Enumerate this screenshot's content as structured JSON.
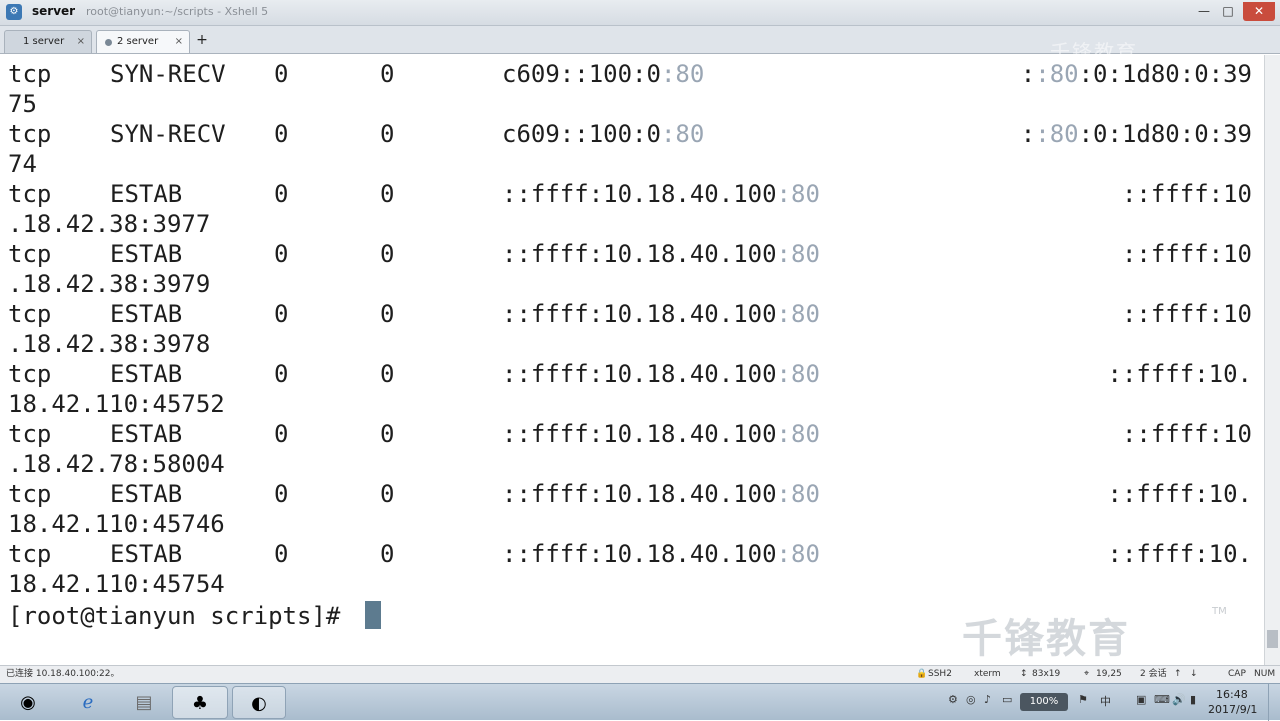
{
  "window": {
    "title": "server",
    "subtitle": "root@tianyun:~/scripts - Xshell 5",
    "minimize": "—",
    "maximize": "□",
    "close": "✕"
  },
  "tabs": [
    {
      "label": "1 server",
      "close": "×"
    },
    {
      "label": "2 server",
      "close": "×"
    }
  ],
  "tab_add": "+",
  "terminal": {
    "rows": [
      {
        "proto": "tcp",
        "state": "SYN-RECV",
        "recvq": "0",
        "sendq": "0",
        "local": "c609::100:0",
        "local_port": ":80",
        "peer_pre": ":",
        "peer_port": ":80",
        "peer_post": ":0:1d80:0:39"
      },
      {
        "wrap": "75"
      },
      {
        "proto": "tcp",
        "state": "SYN-RECV",
        "recvq": "0",
        "sendq": "0",
        "local": "c609::100:0",
        "local_port": ":80",
        "peer_pre": ":",
        "peer_port": ":80",
        "peer_post": ":0:1d80:0:39"
      },
      {
        "wrap": "74"
      },
      {
        "proto": "tcp",
        "state": "ESTAB",
        "recvq": "0",
        "sendq": "0",
        "local": "::ffff:10.18.40.100",
        "local_port": ":80",
        "peer": "::ffff:10"
      },
      {
        "wrap": ".18.42.38:3977"
      },
      {
        "proto": "tcp",
        "state": "ESTAB",
        "recvq": "0",
        "sendq": "0",
        "local": "::ffff:10.18.40.100",
        "local_port": ":80",
        "peer": "::ffff:10"
      },
      {
        "wrap": ".18.42.38:3979"
      },
      {
        "proto": "tcp",
        "state": "ESTAB",
        "recvq": "0",
        "sendq": "0",
        "local": "::ffff:10.18.40.100",
        "local_port": ":80",
        "peer": "::ffff:10"
      },
      {
        "wrap": ".18.42.38:3978"
      },
      {
        "proto": "tcp",
        "state": "ESTAB",
        "recvq": "0",
        "sendq": "0",
        "local": "::ffff:10.18.40.100",
        "local_port": ":80",
        "peer": "::ffff:10."
      },
      {
        "wrap": "18.42.110:45752"
      },
      {
        "proto": "tcp",
        "state": "ESTAB",
        "recvq": "0",
        "sendq": "0",
        "local": "::ffff:10.18.40.100",
        "local_port": ":80",
        "peer": "::ffff:10"
      },
      {
        "wrap": ".18.42.78:58004"
      },
      {
        "proto": "tcp",
        "state": "ESTAB",
        "recvq": "0",
        "sendq": "0",
        "local": "::ffff:10.18.40.100",
        "local_port": ":80",
        "peer": "::ffff:10."
      },
      {
        "wrap": "18.42.110:45746"
      },
      {
        "proto": "tcp",
        "state": "ESTAB",
        "recvq": "0",
        "sendq": "0",
        "local": "::ffff:10.18.40.100",
        "local_port": ":80",
        "peer": "::ffff:10."
      },
      {
        "wrap": "18.42.110:45754"
      }
    ],
    "prompt": "[root@tianyun scripts]# "
  },
  "watermark": {
    "logo": "千锋教育",
    "tm": "TM"
  },
  "statusbar": {
    "connection": "已连接 10.18.40.100:22。",
    "protocol": "SSH2",
    "term": "xterm",
    "size": "83x19",
    "cursor_pos": "19,25",
    "sessions": "2 会话",
    "cap": "CAP",
    "num": "NUM"
  },
  "taskbar": {
    "battery": "100%",
    "time": "16:48",
    "date": "2017/9/1"
  },
  "colors": {
    "port_highlight": "#9aa6b4",
    "close_button": "#c94c3d",
    "cursor": "#5d7b8f"
  }
}
